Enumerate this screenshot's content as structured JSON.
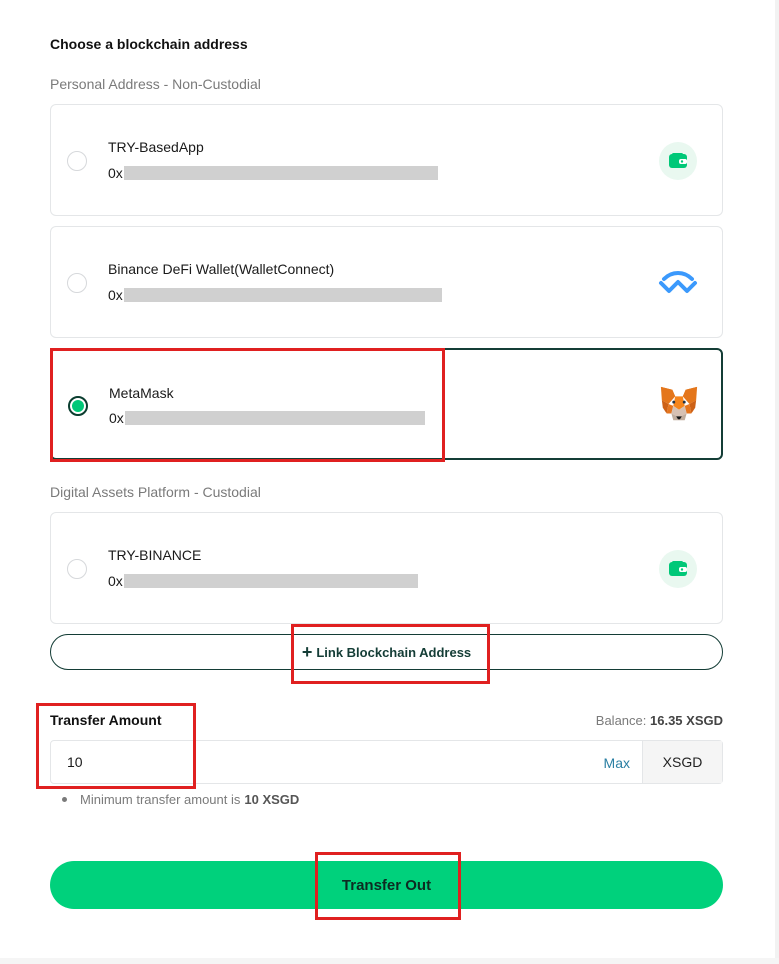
{
  "heading": "Choose a blockchain address",
  "sections": {
    "personal": "Personal Address - Non-Custodial",
    "custodial": "Digital Assets Platform - Custodial"
  },
  "addresses": [
    {
      "name": "TRY-BasedApp",
      "prefix": "0x",
      "icon": "wallet-icon",
      "selected": false
    },
    {
      "name": "Binance DeFi Wallet(WalletConnect)",
      "prefix": "0x",
      "icon": "walletconnect-icon",
      "selected": false
    },
    {
      "name": "MetaMask",
      "prefix": "0x",
      "icon": "metamask-fox-icon",
      "selected": true
    },
    {
      "name": "TRY-BINANCE",
      "prefix": "0x",
      "icon": "wallet-icon",
      "selected": false
    }
  ],
  "link_button": {
    "plus": "+",
    "label": "Link Blockchain Address"
  },
  "transfer": {
    "label": "Transfer Amount",
    "balance_label": "Balance:",
    "balance_value": "16.35 XSGD",
    "amount_value": "10",
    "max_label": "Max",
    "currency": "XSGD",
    "hint_text": "Minimum transfer amount is",
    "hint_value": "10 XSGD",
    "button_label": "Transfer Out"
  },
  "colors": {
    "accent_green": "#00d17c",
    "dark_green": "#143d36",
    "highlight_red": "#e02020",
    "link_blue": "#2a7fa3"
  }
}
